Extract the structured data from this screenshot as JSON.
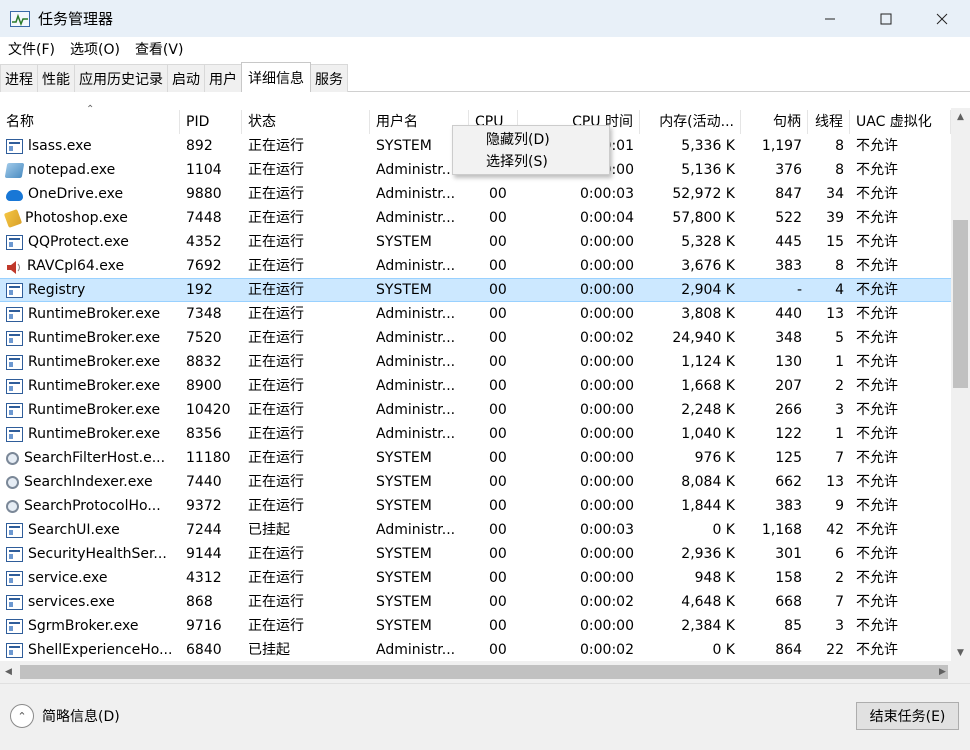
{
  "window": {
    "title": "任务管理器",
    "icon": "task-manager-icon",
    "buttons": [
      "minimize",
      "maximize",
      "close"
    ]
  },
  "menu": [
    "文件(F)",
    "选项(O)",
    "查看(V)"
  ],
  "tabs": [
    "进程",
    "性能",
    "应用历史记录",
    "启动",
    "用户",
    "详细信息",
    "服务"
  ],
  "active_tab": "详细信息",
  "table": {
    "columns": [
      {
        "label": "名称",
        "w": 180
      },
      {
        "label": "PID",
        "w": 62
      },
      {
        "label": "状态",
        "w": 128
      },
      {
        "label": "用户名",
        "w": 99
      },
      {
        "label": "CPU",
        "w": 49
      },
      {
        "label": "CPU 时间",
        "w": 122
      },
      {
        "label": "内存(活动...",
        "w": 101
      },
      {
        "label": "句柄",
        "w": 67
      },
      {
        "label": "线程",
        "w": 42
      },
      {
        "label": "UAC 虚拟化",
        "w": 101
      }
    ],
    "rows": [
      {
        "icon": "window-app-icon",
        "name": "lsass.exe",
        "pid": "892",
        "status": "正在运行",
        "user": "SYSTEM",
        "cpu": "00",
        "cputime": "0:00:01",
        "mem": "5,336 K",
        "handles": "1,197",
        "threads": "8",
        "uac": "不允许"
      },
      {
        "icon": "notepad-icon",
        "name": "notepad.exe",
        "pid": "1104",
        "status": "正在运行",
        "user": "Administr...",
        "cpu": "00",
        "cputime": "0:00:00",
        "mem": "5,136 K",
        "handles": "376",
        "threads": "8",
        "uac": "不允许"
      },
      {
        "icon": "onedrive-icon",
        "name": "OneDrive.exe",
        "pid": "9880",
        "status": "正在运行",
        "user": "Administr...",
        "cpu": "00",
        "cputime": "0:00:03",
        "mem": "52,972 K",
        "handles": "847",
        "threads": "34",
        "uac": "不允许"
      },
      {
        "icon": "photoshop-icon",
        "name": "Photoshop.exe",
        "pid": "7448",
        "status": "正在运行",
        "user": "Administr...",
        "cpu": "00",
        "cputime": "0:00:04",
        "mem": "57,800 K",
        "handles": "522",
        "threads": "39",
        "uac": "不允许"
      },
      {
        "icon": "window-app-icon",
        "name": "QQProtect.exe",
        "pid": "4352",
        "status": "正在运行",
        "user": "SYSTEM",
        "cpu": "00",
        "cputime": "0:00:00",
        "mem": "5,328 K",
        "handles": "445",
        "threads": "15",
        "uac": "不允许"
      },
      {
        "icon": "speaker-icon",
        "name": "RAVCpl64.exe",
        "pid": "7692",
        "status": "正在运行",
        "user": "Administr...",
        "cpu": "00",
        "cputime": "0:00:00",
        "mem": "3,676 K",
        "handles": "383",
        "threads": "8",
        "uac": "不允许"
      },
      {
        "icon": "window-app-icon",
        "name": "Registry",
        "pid": "192",
        "status": "正在运行",
        "user": "SYSTEM",
        "cpu": "00",
        "cputime": "0:00:00",
        "mem": "2,904 K",
        "handles": "-",
        "threads": "4",
        "uac": "不允许",
        "selected": true
      },
      {
        "icon": "window-app-icon",
        "name": "RuntimeBroker.exe",
        "pid": "7348",
        "status": "正在运行",
        "user": "Administr...",
        "cpu": "00",
        "cputime": "0:00:00",
        "mem": "3,808 K",
        "handles": "440",
        "threads": "13",
        "uac": "不允许"
      },
      {
        "icon": "window-app-icon",
        "name": "RuntimeBroker.exe",
        "pid": "7520",
        "status": "正在运行",
        "user": "Administr...",
        "cpu": "00",
        "cputime": "0:00:02",
        "mem": "24,940 K",
        "handles": "348",
        "threads": "5",
        "uac": "不允许"
      },
      {
        "icon": "window-app-icon",
        "name": "RuntimeBroker.exe",
        "pid": "8832",
        "status": "正在运行",
        "user": "Administr...",
        "cpu": "00",
        "cputime": "0:00:00",
        "mem": "1,124 K",
        "handles": "130",
        "threads": "1",
        "uac": "不允许"
      },
      {
        "icon": "window-app-icon",
        "name": "RuntimeBroker.exe",
        "pid": "8900",
        "status": "正在运行",
        "user": "Administr...",
        "cpu": "00",
        "cputime": "0:00:00",
        "mem": "1,668 K",
        "handles": "207",
        "threads": "2",
        "uac": "不允许"
      },
      {
        "icon": "window-app-icon",
        "name": "RuntimeBroker.exe",
        "pid": "10420",
        "status": "正在运行",
        "user": "Administr...",
        "cpu": "00",
        "cputime": "0:00:00",
        "mem": "2,248 K",
        "handles": "266",
        "threads": "3",
        "uac": "不允许"
      },
      {
        "icon": "window-app-icon",
        "name": "RuntimeBroker.exe",
        "pid": "8356",
        "status": "正在运行",
        "user": "Administr...",
        "cpu": "00",
        "cputime": "0:00:00",
        "mem": "1,040 K",
        "handles": "122",
        "threads": "1",
        "uac": "不允许"
      },
      {
        "icon": "search-service-icon",
        "name": "SearchFilterHost.e...",
        "pid": "11180",
        "status": "正在运行",
        "user": "SYSTEM",
        "cpu": "00",
        "cputime": "0:00:00",
        "mem": "976 K",
        "handles": "125",
        "threads": "7",
        "uac": "不允许"
      },
      {
        "icon": "search-service-icon",
        "name": "SearchIndexer.exe",
        "pid": "7440",
        "status": "正在运行",
        "user": "SYSTEM",
        "cpu": "00",
        "cputime": "0:00:00",
        "mem": "8,084 K",
        "handles": "662",
        "threads": "13",
        "uac": "不允许"
      },
      {
        "icon": "search-service-icon",
        "name": "SearchProtocolHo...",
        "pid": "9372",
        "status": "正在运行",
        "user": "SYSTEM",
        "cpu": "00",
        "cputime": "0:00:00",
        "mem": "1,844 K",
        "handles": "383",
        "threads": "9",
        "uac": "不允许"
      },
      {
        "icon": "window-app-icon",
        "name": "SearchUI.exe",
        "pid": "7244",
        "status": "已挂起",
        "user": "Administr...",
        "cpu": "00",
        "cputime": "0:00:03",
        "mem": "0 K",
        "handles": "1,168",
        "threads": "42",
        "uac": "不允许"
      },
      {
        "icon": "window-app-icon",
        "name": "SecurityHealthSer...",
        "pid": "9144",
        "status": "正在运行",
        "user": "SYSTEM",
        "cpu": "00",
        "cputime": "0:00:00",
        "mem": "2,936 K",
        "handles": "301",
        "threads": "6",
        "uac": "不允许"
      },
      {
        "icon": "window-app-icon",
        "name": "service.exe",
        "pid": "4312",
        "status": "正在运行",
        "user": "SYSTEM",
        "cpu": "00",
        "cputime": "0:00:00",
        "mem": "948 K",
        "handles": "158",
        "threads": "2",
        "uac": "不允许"
      },
      {
        "icon": "window-app-icon",
        "name": "services.exe",
        "pid": "868",
        "status": "正在运行",
        "user": "SYSTEM",
        "cpu": "00",
        "cputime": "0:00:02",
        "mem": "4,648 K",
        "handles": "668",
        "threads": "7",
        "uac": "不允许"
      },
      {
        "icon": "window-app-icon",
        "name": "SgrmBroker.exe",
        "pid": "9716",
        "status": "正在运行",
        "user": "SYSTEM",
        "cpu": "00",
        "cputime": "0:00:00",
        "mem": "2,384 K",
        "handles": "85",
        "threads": "3",
        "uac": "不允许"
      },
      {
        "icon": "window-app-icon",
        "name": "ShellExperienceHo...",
        "pid": "6840",
        "status": "已挂起",
        "user": "Administr...",
        "cpu": "00",
        "cputime": "0:00:02",
        "mem": "0 K",
        "handles": "864",
        "threads": "22",
        "uac": "不允许"
      }
    ]
  },
  "context_menu": [
    "隐藏列(D)",
    "选择列(S)"
  ],
  "footer": {
    "fewer_details": "简略信息(D)",
    "end_task": "结束任务(E)"
  },
  "colors": {
    "selected_row": "#cce8ff",
    "titlebar": "#e8f0f8"
  }
}
